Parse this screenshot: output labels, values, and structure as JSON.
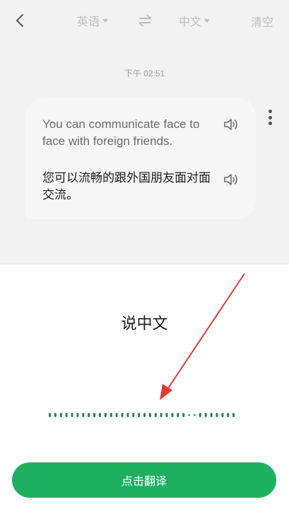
{
  "header": {
    "source_language": "英语",
    "target_language": "中文",
    "clear_label": "清空"
  },
  "conversation": {
    "timestamp": "下午 02:51",
    "message": {
      "original_text": "You can communicate face to face with foreign friends.",
      "translated_text": "您可以流畅的跟外国朋友面对面交流。"
    }
  },
  "voice_panel": {
    "prompt": "说中文",
    "translate_button_label": "点击翻译"
  },
  "colors": {
    "accent": "#1db060",
    "annotation_arrow": "#e53935"
  },
  "icons": {
    "back": "chevron-left-icon",
    "swap": "swap-arrows-icon",
    "speaker": "speaker-icon",
    "more": "more-vertical-icon"
  }
}
